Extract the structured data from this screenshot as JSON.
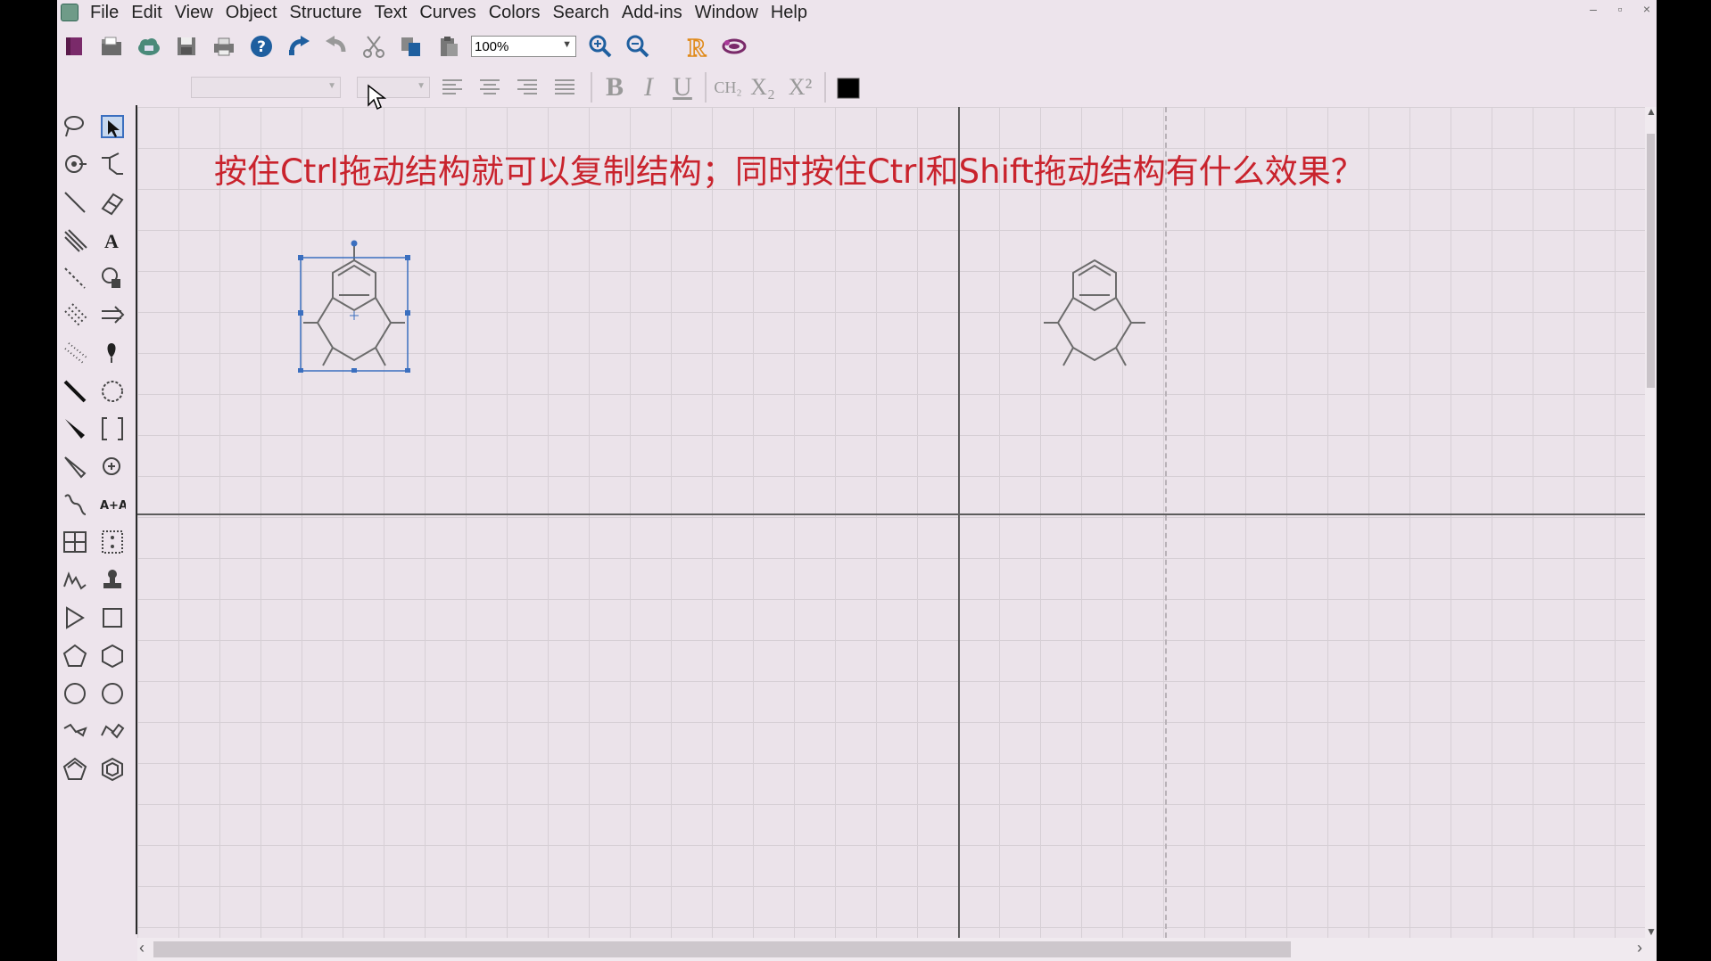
{
  "menu": {
    "items": [
      "File",
      "Edit",
      "View",
      "Object",
      "Structure",
      "Text",
      "Curves",
      "Colors",
      "Search",
      "Add-ins",
      "Window",
      "Help"
    ]
  },
  "toolbar": {
    "zoom_value": "100%",
    "font_select_value": "",
    "size_select_value": "",
    "bold_label": "B",
    "italic_label": "I",
    "underline_label": "U",
    "formula_label": "CH₂",
    "subscript_label": "X₂",
    "superscript_label": "X²",
    "text_color": "#000000"
  },
  "canvas": {
    "instruction_text": "按住Ctrl拖动结构就可以复制结构；同时按住Ctrl和Shift拖动结构有什么效果？",
    "instruction_color": "#c9232d"
  }
}
